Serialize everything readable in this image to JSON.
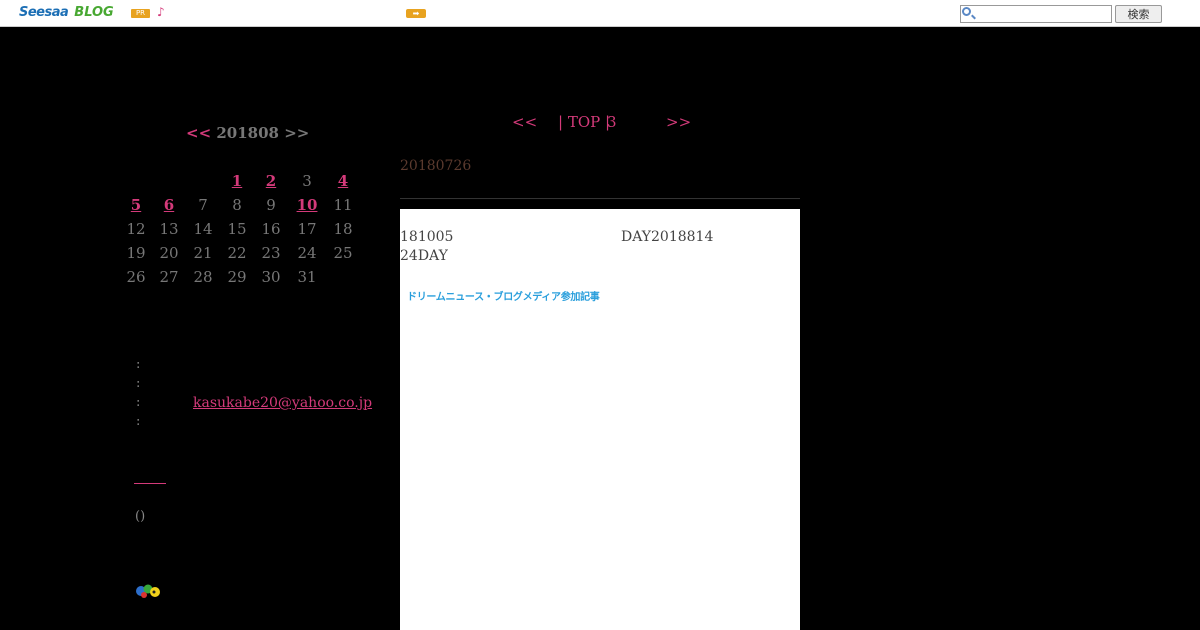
{
  "topbar": {
    "logo_seesaa": "Seesaa",
    "logo_blog": "BLOG",
    "pr_badge": "PR",
    "note_glyph": "♪",
    "arrow_glyph": "➡",
    "search_placeholder": "",
    "search_button": "検索",
    "accent_color": "#e8a320"
  },
  "calendar": {
    "prev": "<<",
    "month": "201808",
    "next": ">>",
    "weeks": [
      [
        "",
        "",
        "",
        "1",
        "2",
        "3",
        "4"
      ],
      [
        "5",
        "6",
        "7",
        "8",
        "9",
        "10",
        "11"
      ],
      [
        "12",
        "13",
        "14",
        "15",
        "16",
        "17",
        "18"
      ],
      [
        "19",
        "20",
        "21",
        "22",
        "23",
        "24",
        "25"
      ],
      [
        "26",
        "27",
        "28",
        "29",
        "30",
        "31",
        ""
      ]
    ],
    "linked_days": [
      "1",
      "2",
      "4",
      "5",
      "6",
      "10"
    ],
    "link_color": "#d43a7a"
  },
  "profile": {
    "rows": [
      ":",
      ":",
      ":",
      ":"
    ],
    "email": "kasukabe20@yahoo.co.jp"
  },
  "sidebar_paren": "()",
  "pager": {
    "prev": "<<",
    "top": "| TOP |",
    "page": "3",
    "next": ">>"
  },
  "post": {
    "date": "20180726",
    "line1_left": "181005",
    "line1_right": "DAY2018814",
    "line2": "24DAY",
    "dream_link": "ドリームニュース・ブログメディア参加記事"
  }
}
